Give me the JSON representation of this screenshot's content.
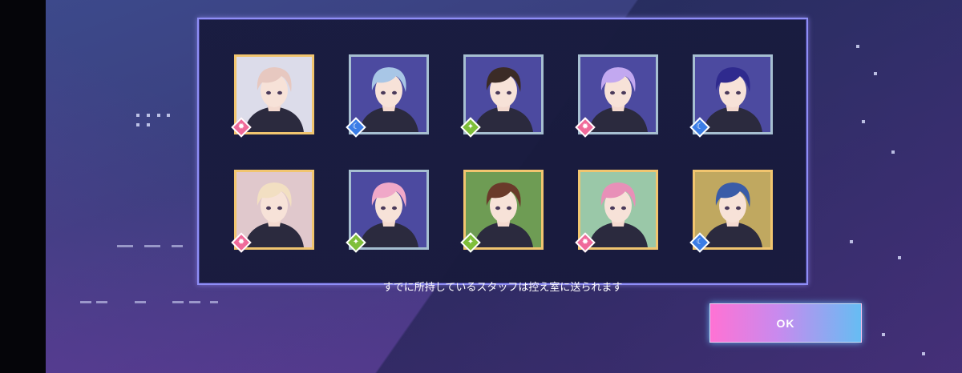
{
  "notice_text": "すでに所持しているスタッフは控え室に送られます",
  "ok_button_label": "OK",
  "colors": {
    "panel_border": "#8f8ef7",
    "frame_gold": "#f1c56f",
    "frame_silver": "#a6bfd1",
    "attr_sun": "#f06a9a",
    "attr_moon": "#3b7de6",
    "attr_star": "#7fbf3a"
  },
  "staff_rows": [
    [
      {
        "frame": "gold",
        "attribute": "sun-icon",
        "hair": "#e7c8c0",
        "bg": "#dcdcea"
      },
      {
        "frame": "silver",
        "attribute": "moon-icon",
        "hair": "#a8c6e6",
        "bg": "#4c4aa0"
      },
      {
        "frame": "silver",
        "attribute": "star-icon",
        "hair": "#3b2b26",
        "bg": "#4c4aa0"
      },
      {
        "frame": "silver",
        "attribute": "sun-icon",
        "hair": "#c2a8f0",
        "bg": "#4c4aa0"
      },
      {
        "frame": "silver",
        "attribute": "moon-icon",
        "hair": "#2f2a8e",
        "bg": "#4c4aa0"
      }
    ],
    [
      {
        "frame": "gold",
        "attribute": "sun-icon",
        "hair": "#f2dfc2",
        "bg": "#e0c8cc"
      },
      {
        "frame": "silver",
        "attribute": "star-icon",
        "hair": "#f0a8c8",
        "bg": "#4c4aa0"
      },
      {
        "frame": "gold",
        "attribute": "star-icon",
        "hair": "#6a3a2a",
        "bg": "#6e9c54"
      },
      {
        "frame": "gold",
        "attribute": "sun-icon",
        "hair": "#e890b8",
        "bg": "#9ac8a8"
      },
      {
        "frame": "gold",
        "attribute": "moon-icon",
        "hair": "#3a5ca8",
        "bg": "#c0a860"
      }
    ]
  ]
}
